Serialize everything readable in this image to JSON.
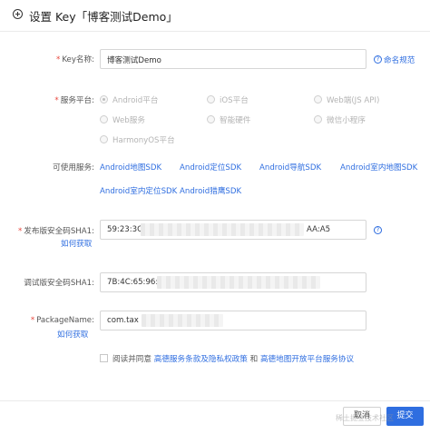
{
  "dialog": {
    "title": "设置 Key「博客测试Demo」"
  },
  "form": {
    "key_name": {
      "label": "Key名称:",
      "value": "博客测试Demo",
      "help_link": "命名规范"
    },
    "platform": {
      "label": "服务平台:",
      "options": [
        {
          "label": "Android平台",
          "selected": true
        },
        {
          "label": "iOS平台",
          "selected": false
        },
        {
          "label": "Web端(JS API)",
          "selected": false
        },
        {
          "label": "Web服务",
          "selected": false
        },
        {
          "label": "智能硬件",
          "selected": false
        },
        {
          "label": "微信小程序",
          "selected": false
        },
        {
          "label": "HarmonyOS平台",
          "selected": false
        }
      ]
    },
    "services": {
      "label": "可使用服务:",
      "items": [
        "Android地图SDK",
        "Android定位SDK",
        "Android导航SDK",
        "Android室内地图SDK",
        "Android室内定位SDK",
        "Android猎鹰SDK"
      ]
    },
    "release_sha1": {
      "label": "发布版安全码SHA1:",
      "value_start": "59:23:3C",
      "value_end": "AA:A5",
      "help_link": "如何获取"
    },
    "debug_sha1": {
      "label": "调试版安全码SHA1:",
      "value_start": "7B:4C:65:96:1"
    },
    "package": {
      "label": "PackageName:",
      "value_start": "com.tax",
      "help_link": "如何获取"
    },
    "agreement": {
      "prefix": "阅读并同意",
      "link1": "高德服务条款及隐私权政策",
      "connector": "和",
      "link2": "高德地图开放平台服务协议"
    }
  },
  "footer": {
    "cancel_label": "取消",
    "submit_label": "提交"
  },
  "watermark": "稀土掘金技术社区",
  "colors": {
    "link": "#2f6ee0",
    "required": "#e8463c",
    "primary_button": "#2f6ee0"
  }
}
